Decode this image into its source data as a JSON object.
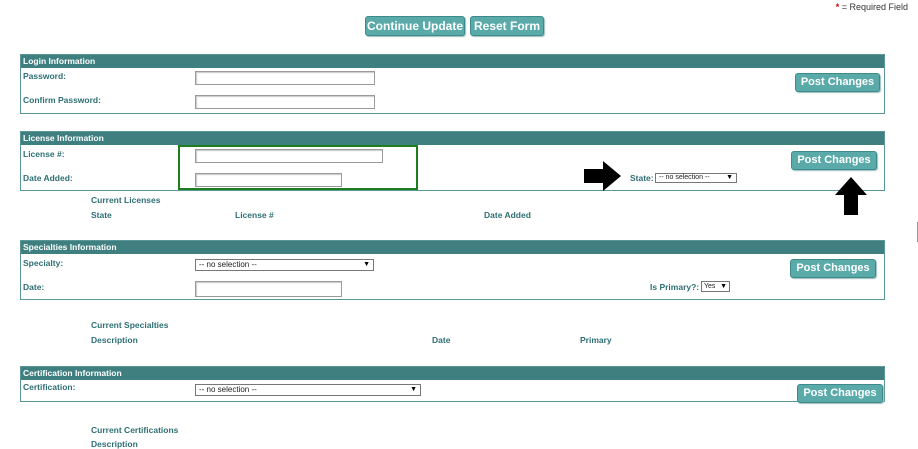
{
  "required_note": {
    "star": "*",
    "text": " = Required Field"
  },
  "toolbar": {
    "continue_label": "Continue Update",
    "reset_label": "Reset Form"
  },
  "login": {
    "header": "Login Information",
    "password_label": "Password:",
    "confirm_label": "Confirm Password:",
    "post_label": "Post Changes"
  },
  "license": {
    "header": "License Information",
    "number_label": "License #:",
    "date_label": "Date Added:",
    "state_label": "State:",
    "state_value": "-- no selection --",
    "post_label": "Post Changes",
    "current_title": "Current Licenses",
    "columns": [
      "State",
      "License #",
      "Date Added"
    ]
  },
  "specialties": {
    "header": "Specialties Information",
    "specialty_label": "Specialty:",
    "specialty_value": "-- no selection --",
    "date_label": "Date:",
    "primary_label": "Is Primary?:",
    "primary_value": "Yes",
    "post_label": "Post Changes",
    "current_title": "Current Specialties",
    "columns": [
      "Description",
      "Date",
      "Primary"
    ]
  },
  "certification": {
    "header": "Certification Information",
    "cert_label": "Certification:",
    "cert_value": "-- no selection --",
    "post_label": "Post Changes",
    "current_title": "Current Certifications",
    "columns": [
      "Description"
    ]
  },
  "colors": {
    "accent": "#5aaaaa",
    "header": "#3f7f80",
    "highlight": "#1e7d1e"
  }
}
